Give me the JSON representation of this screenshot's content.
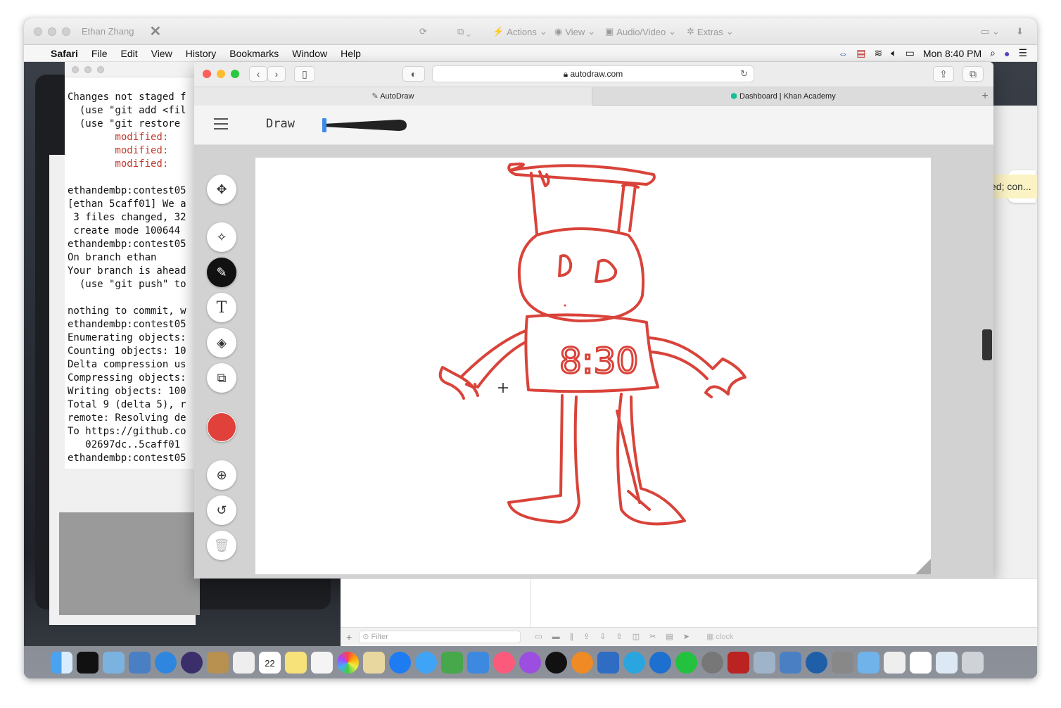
{
  "remote": {
    "title": "Ethan Zhang",
    "actions": "Actions",
    "view": "View",
    "audio_video": "Audio/Video",
    "extras": "Extras"
  },
  "menubar": {
    "app": "Safari",
    "items": [
      "File",
      "Edit",
      "View",
      "History",
      "Bookmarks",
      "Window",
      "Help"
    ],
    "clock": "Mon 8:40 PM"
  },
  "terminal": {
    "lines": [
      {
        "text": "Changes not staged f",
        "red": false
      },
      {
        "text": "  (use \"git add <fil",
        "red": false
      },
      {
        "text": "  (use \"git restore",
        "red": false
      },
      {
        "text": "        modified:",
        "red": true
      },
      {
        "text": "        modified:",
        "red": true
      },
      {
        "text": "        modified:",
        "red": true
      },
      {
        "text": "",
        "red": false
      },
      {
        "text": "ethandembp:contest05",
        "red": false
      },
      {
        "text": "[ethan 5caff01] We a",
        "red": false
      },
      {
        "text": " 3 files changed, 32",
        "red": false
      },
      {
        "text": " create mode 100644",
        "red": false
      },
      {
        "text": "ethandembp:contest05",
        "red": false
      },
      {
        "text": "On branch ethan",
        "red": false
      },
      {
        "text": "Your branch is ahead",
        "red": false
      },
      {
        "text": "  (use \"git push\" to",
        "red": false
      },
      {
        "text": "",
        "red": false
      },
      {
        "text": "nothing to commit, w",
        "red": false
      },
      {
        "text": "ethandembp:contest05",
        "red": false
      },
      {
        "text": "Enumerating objects:",
        "red": false
      },
      {
        "text": "Counting objects: 10",
        "red": false
      },
      {
        "text": "Delta compression us",
        "red": false
      },
      {
        "text": "Compressing objects:",
        "red": false
      },
      {
        "text": "Writing objects: 100",
        "red": false
      },
      {
        "text": "Total 9 (delta 5), r",
        "red": false
      },
      {
        "text": "remote: Resolving de",
        "red": false
      },
      {
        "text": "To https://github.co",
        "red": false
      },
      {
        "text": "   02697dc..5caff01",
        "red": false
      },
      {
        "text": "ethandembp:contest05",
        "red": false
      }
    ]
  },
  "safari": {
    "url": "autodraw.com",
    "tabs": [
      {
        "label": "AutoDraw"
      },
      {
        "label": "Dashboard | Khan Academy"
      }
    ]
  },
  "autodraw": {
    "mode_label": "Draw",
    "drawing_text": "8:30",
    "stroke_color": "#d9433a",
    "brush_size": 0.05
  },
  "background": {
    "yellow_note": "ed; con...",
    "filter_placeholder": "Filter",
    "clock_field": "clock"
  },
  "dock": {
    "calendar_day": "22"
  }
}
